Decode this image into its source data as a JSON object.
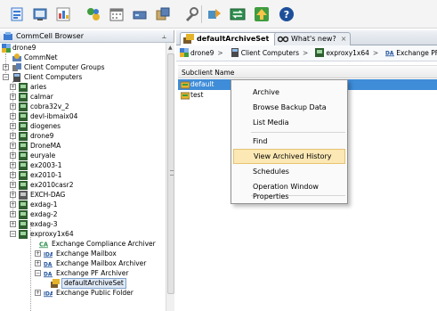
{
  "toolbar": {
    "buttons": [
      {
        "name": "backup-job-icon",
        "color": "#3c7bd1"
      },
      {
        "name": "console-icon",
        "color": "#5b8ec9"
      },
      {
        "name": "reports-icon",
        "color": "#d64c4c"
      },
      {
        "name": "storage-icon",
        "color": "#3f9c3f"
      },
      {
        "name": "calendar-icon",
        "color": "#7a7a7a"
      },
      {
        "name": "drive-icon",
        "color": "#5a7fb5"
      },
      {
        "name": "inventory-icon",
        "color": "#8b6f3a"
      },
      {
        "name": "tools-icon",
        "color": "#6a6a6a"
      },
      {
        "name": "workflow-icon",
        "color": "#4c8fc2"
      },
      {
        "name": "switch-icon",
        "color": "#2f8f4f"
      },
      {
        "name": "up-arrow-icon",
        "color": "#e59c2b"
      },
      {
        "name": "help-icon",
        "color": "#1d4f9a"
      }
    ]
  },
  "left_pane": {
    "title": "CommCell Browser",
    "pin": "⫠"
  },
  "tree": {
    "root": "drone9",
    "commnet": "CommNet",
    "client_groups": "Client Computer Groups",
    "client_computers": "Client Computers",
    "clients": [
      "aries",
      "calmar",
      "cobra32v_2",
      "devl-ibmaix04",
      "diogenes",
      "drone9",
      "DroneMA",
      "euryale",
      "ex2003-1",
      "ex2010-1",
      "ex2010casr2",
      "EXCH-DAG",
      "exdag-1",
      "exdag-2",
      "exdag-3",
      "exproxy1x64"
    ],
    "agents": [
      "Exchange Compliance Archiver",
      "Exchange Mailbox",
      "Exchange Mailbox Archiver",
      "Exchange PF Archiver"
    ],
    "subclient_set": "defaultArchiveSet",
    "public_folder": "Exchange Public Folder"
  },
  "tabs": [
    {
      "label": "defaultArchiveSet",
      "close": "×",
      "active": true
    },
    {
      "label": "What's new?",
      "close": "×",
      "active": false
    }
  ],
  "breadcrumb": {
    "items": [
      "drone9",
      "Client Computers",
      "exproxy1x64",
      "Exchange PF A"
    ],
    "sep": ">"
  },
  "grid": {
    "column": "Subclient Name",
    "rows": [
      "default",
      "test"
    ],
    "selected_color": "#3f8cd8"
  },
  "context_menu": {
    "items": [
      "Archive",
      "Browse Backup Data",
      "List Media",
      "Find",
      "View Archived History",
      "Schedules",
      "Operation Window",
      "Properties"
    ],
    "highlighted": "View Archived History",
    "highlight_color": "#fbe8b4"
  }
}
